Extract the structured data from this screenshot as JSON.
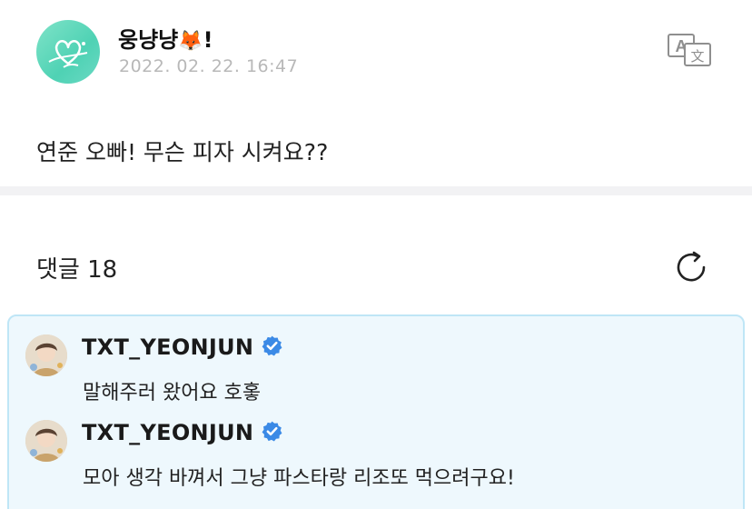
{
  "post": {
    "author_name": "웅냥냥",
    "author_emoji": "🦊",
    "author_suffix": "!",
    "timestamp": "2022. 02. 22. 16:47",
    "body": "연준 오빠! 무슨 피자 시켜요??"
  },
  "comments_section": {
    "title": "댓글 18"
  },
  "comments": [
    {
      "author": "TXT_YEONJUN",
      "text": "말해주러 왔어요 호홓"
    },
    {
      "author": "TXT_YEONJUN",
      "text": "모아 생각 바껴서 그냥 파스타랑 리조또 먹으려구요!"
    }
  ],
  "colors": {
    "accent_verified": "#3b8ae6",
    "comment_bg": "#eef8fd",
    "comment_border": "#bfe6f6",
    "timestamp": "#b8b8b8",
    "divider": "#f2f2f4"
  },
  "icons": {
    "translate": "translate-icon",
    "refresh": "refresh-icon",
    "verified": "verified-badge-icon"
  }
}
